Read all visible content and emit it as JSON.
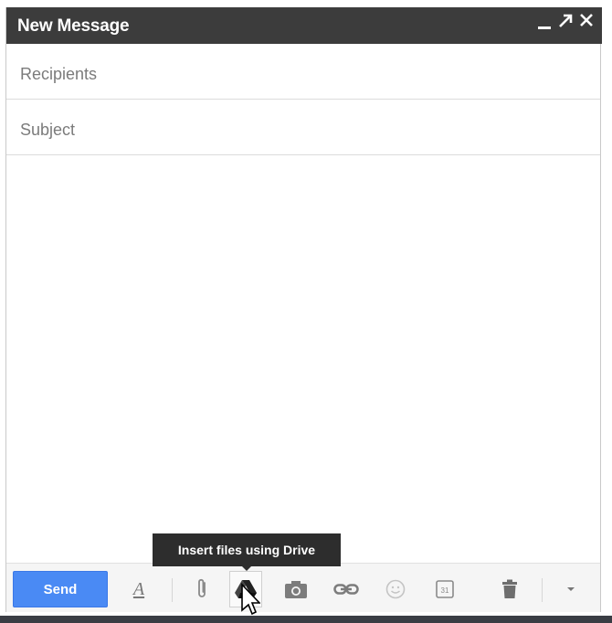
{
  "window": {
    "title": "New Message",
    "controls": {
      "minimize": "minimize-icon",
      "popout": "pop-out-icon",
      "close": "close-icon"
    }
  },
  "fields": {
    "recipients_placeholder": "Recipients",
    "subject_placeholder": "Subject"
  },
  "toolbar": {
    "send_label": "Send",
    "icons": [
      "text-format-icon",
      "attach-icon",
      "drive-icon",
      "photo-icon",
      "link-icon",
      "emoji-icon",
      "calendar-icon",
      "trash-icon",
      "more-options-icon"
    ],
    "calendar_day": "31"
  },
  "tooltip": {
    "text": "Insert files using Drive"
  },
  "colors": {
    "titlebar": "#3c3c3c",
    "send": "#4a8af4",
    "tooltip": "#2d2d2d"
  }
}
